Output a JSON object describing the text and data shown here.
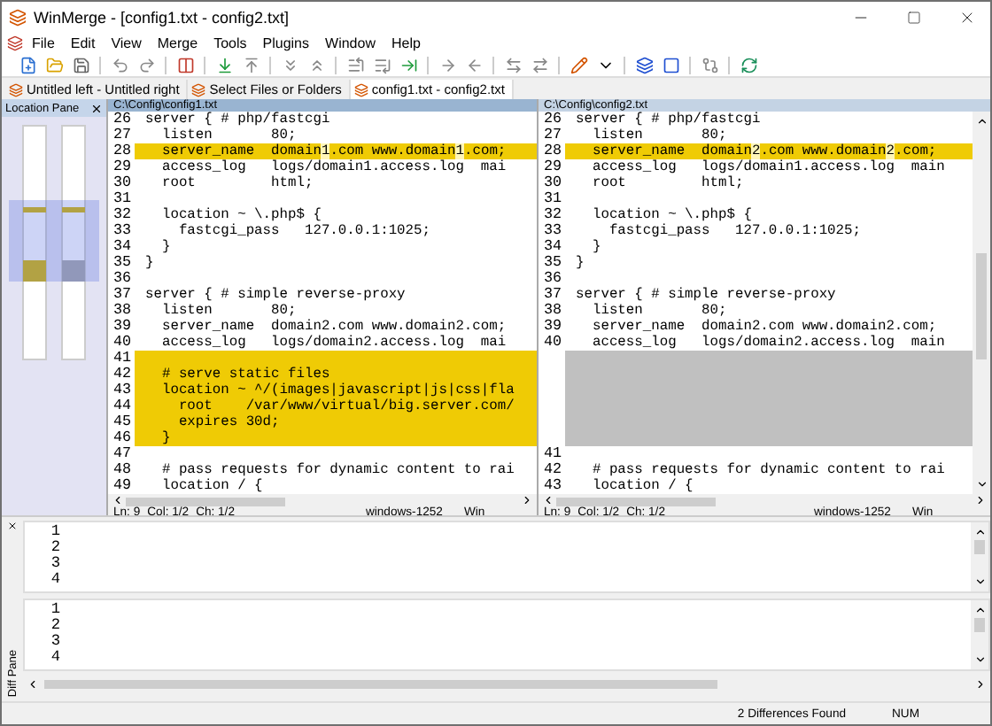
{
  "window": {
    "title": "WinMerge - [config1.txt - config2.txt]"
  },
  "menu": [
    "File",
    "Edit",
    "View",
    "Merge",
    "Tools",
    "Plugins",
    "Window",
    "Help"
  ],
  "tabs": [
    {
      "label": "Untitled left - Untitled right",
      "selected": false
    },
    {
      "label": "Select Files or Folders",
      "selected": false
    },
    {
      "label": "config1.txt - config2.txt",
      "selected": true
    }
  ],
  "location_pane": {
    "title": "Location Pane"
  },
  "panes": [
    {
      "path": "C:\\Config\\config1.txt",
      "active": true,
      "lines": [
        {
          "kind": "same",
          "number": "26",
          "text": "server { # php/fastcgi"
        },
        {
          "kind": "same",
          "number": "27",
          "text": "  listen       80;"
        },
        {
          "kind": "diff",
          "number": "28",
          "parts": [
            {
              "text": "  server_name  domain",
              "changed": false
            },
            {
              "text": "1",
              "changed": true
            },
            {
              "text": ".com www.domain",
              "changed": false
            },
            {
              "text": "1",
              "changed": true
            },
            {
              "text": ".com;",
              "changed": false
            }
          ]
        },
        {
          "kind": "same",
          "number": "29",
          "text": "  access_log   logs/domain1.access.log  mai"
        },
        {
          "kind": "same",
          "number": "30",
          "text": "  root         html;"
        },
        {
          "kind": "same",
          "number": "31"
        },
        {
          "kind": "same",
          "number": "32",
          "text": "  location ~ \\.php$ {"
        },
        {
          "kind": "same",
          "number": "33",
          "text": "    fastcgi_pass   127.0.0.1:1025;"
        },
        {
          "kind": "same",
          "number": "34",
          "text": "  }"
        },
        {
          "kind": "same",
          "number": "35",
          "text": "}"
        },
        {
          "kind": "same",
          "number": "36"
        },
        {
          "kind": "same",
          "number": "37",
          "text": "server { # simple reverse-proxy"
        },
        {
          "kind": "same",
          "number": "38",
          "text": "  listen       80;"
        },
        {
          "kind": "same",
          "number": "39",
          "text": "  server_name  domain2.com www.domain2.com;"
        },
        {
          "kind": "same",
          "number": "40",
          "text": "  access_log   logs/domain2.access.log  mai"
        },
        {
          "kind": "diff",
          "number": "41"
        },
        {
          "kind": "diff",
          "number": "42",
          "text": "  # serve static files"
        },
        {
          "kind": "diff",
          "number": "43",
          "text": "  location ~ ^/(images|javascript|js|css|fla"
        },
        {
          "kind": "diff",
          "number": "44",
          "text": "    root    /var/www/virtual/big.server.com/"
        },
        {
          "kind": "diff",
          "number": "45",
          "text": "    expires 30d;"
        },
        {
          "kind": "diff",
          "number": "46",
          "text": "  }"
        },
        {
          "kind": "same",
          "number": "47"
        },
        {
          "kind": "same",
          "number": "48",
          "text": "  # pass requests for dynamic content to rai"
        },
        {
          "kind": "same",
          "number": "49",
          "text": "  location / {"
        }
      ],
      "status": {
        "line": "Ln: 9",
        "column": "Col: 1/2",
        "char": "Ch: 1/2",
        "encoding": "windows-1252",
        "eol": "Win"
      }
    },
    {
      "path": "C:\\Config\\config2.txt",
      "active": false,
      "lines": [
        {
          "kind": "same",
          "number": "26",
          "text": "server { # php/fastcgi"
        },
        {
          "kind": "same",
          "number": "27",
          "text": "  listen       80;"
        },
        {
          "kind": "diff",
          "number": "28",
          "parts": [
            {
              "text": "  server_name  domain",
              "changed": false
            },
            {
              "text": "2",
              "changed": true
            },
            {
              "text": ".com www.domain",
              "changed": false
            },
            {
              "text": "2",
              "changed": true
            },
            {
              "text": ".com;",
              "changed": false
            }
          ]
        },
        {
          "kind": "same",
          "number": "29",
          "text": "  access_log   logs/domain1.access.log  main"
        },
        {
          "kind": "same",
          "number": "30",
          "text": "  root         html;"
        },
        {
          "kind": "same",
          "number": "31"
        },
        {
          "kind": "same",
          "number": "32",
          "text": "  location ~ \\.php$ {"
        },
        {
          "kind": "same",
          "number": "33",
          "text": "    fastcgi_pass   127.0.0.1:1025;"
        },
        {
          "kind": "same",
          "number": "34",
          "text": "  }"
        },
        {
          "kind": "same",
          "number": "35",
          "text": "}"
        },
        {
          "kind": "same",
          "number": "36"
        },
        {
          "kind": "same",
          "number": "37",
          "text": "server { # simple reverse-proxy"
        },
        {
          "kind": "same",
          "number": "38",
          "text": "  listen       80;"
        },
        {
          "kind": "same",
          "number": "39",
          "text": "  server_name  domain2.com www.domain2.com;"
        },
        {
          "kind": "same",
          "number": "40",
          "text": "  access_log   logs/domain2.access.log  main"
        },
        {
          "kind": "ghost"
        },
        {
          "kind": "ghost"
        },
        {
          "kind": "ghost"
        },
        {
          "kind": "ghost"
        },
        {
          "kind": "ghost"
        },
        {
          "kind": "ghost"
        },
        {
          "kind": "same",
          "number": "41"
        },
        {
          "kind": "same",
          "number": "42",
          "text": "  # pass requests for dynamic content to rai"
        },
        {
          "kind": "same",
          "number": "43",
          "text": "  location / {"
        }
      ],
      "status": {
        "line": "Ln: 9",
        "column": "Col: 1/2",
        "char": "Ch: 1/2",
        "encoding": "windows-1252",
        "eol": "Win"
      }
    }
  ],
  "diff_pane": {
    "title": "Diff Pane",
    "panels": [
      {
        "line_numbers": [
          "1",
          "2",
          "3",
          "4"
        ]
      },
      {
        "line_numbers": [
          "1",
          "2",
          "3",
          "4"
        ]
      }
    ]
  },
  "status_bar": {
    "differences": "2 Differences Found",
    "num_lock": "NUM"
  }
}
